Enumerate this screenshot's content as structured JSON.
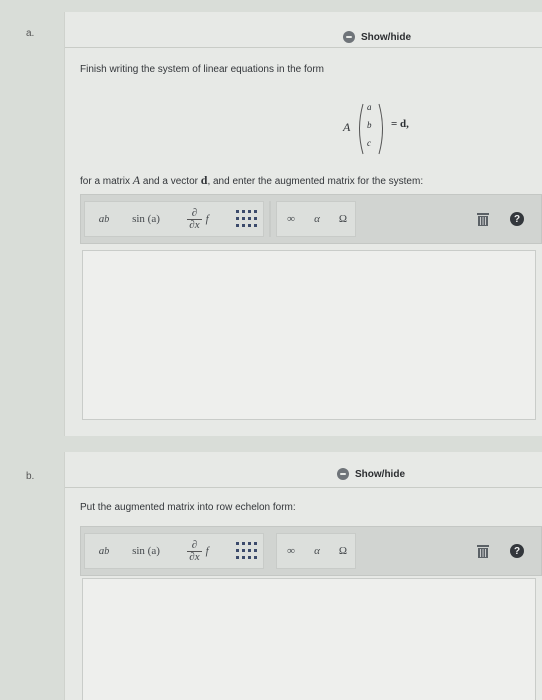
{
  "part_a": {
    "label": "a.",
    "showhide": "Show/hide",
    "prompt1": "Finish writing the system of linear equations in the form",
    "equation": {
      "matrix": "A",
      "vector": [
        "a",
        "b",
        "c"
      ],
      "rhs": "= d,"
    },
    "prompt2": {
      "before": "for a matrix",
      "matrix": "A",
      "mid": "and a vector",
      "vector": "d",
      "after": ", and enter the augmented matrix for the system:"
    }
  },
  "part_b": {
    "label": "b.",
    "showhide": "Show/hide",
    "prompt": "Put the augmented matrix into row echelon form:"
  },
  "toolbar": {
    "power_base": "a",
    "power_exp": "b",
    "sin": "sin (a)",
    "partial_top": "∂",
    "partial_bottom": "∂x",
    "partial_f": "f",
    "infinity": "∞",
    "alpha": "α",
    "omega": "Ω",
    "help": "?"
  }
}
